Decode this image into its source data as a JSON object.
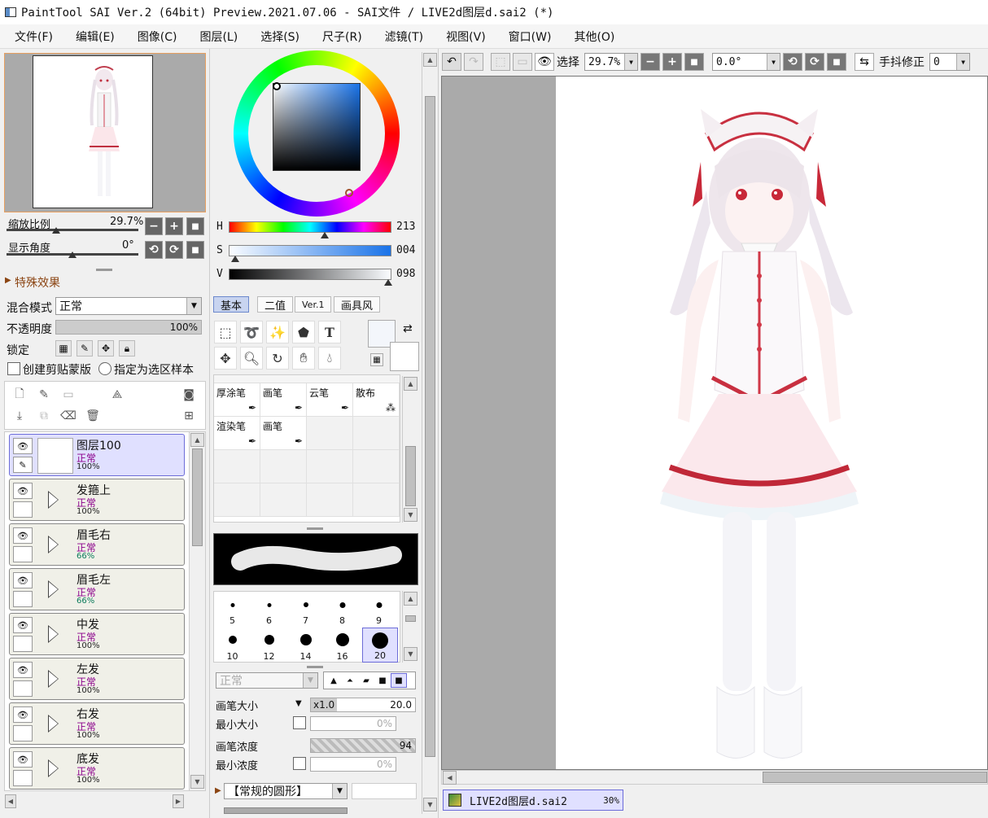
{
  "window": {
    "title": "PaintTool SAI Ver.2 (64bit) Preview.2021.07.06 - SAI文件 / LIVE2d图层d.sai2 (*)"
  },
  "menu": [
    "文件(F)",
    "编辑(E)",
    "图像(C)",
    "图层(L)",
    "选择(S)",
    "尺子(R)",
    "滤镜(T)",
    "视图(V)",
    "窗口(W)",
    "其他(O)"
  ],
  "navigator": {
    "zoom_label": "缩放比例",
    "zoom_value": "29.7%",
    "angle_label": "显示角度",
    "angle_value": "0°",
    "minus": "−",
    "plus": "+",
    "reset": "■",
    "rotate_ccw": "⟲",
    "rotate_cw": "⟳"
  },
  "layer_panel": {
    "effects_label": "特殊效果",
    "blend_label": "混合模式",
    "blend_value": "正常",
    "opacity_label": "不透明度",
    "opacity_value": "100%",
    "lock_label": "锁定",
    "clip_label": "创建剪贴蒙版",
    "selection_source_label": "指定为选区样本",
    "layers": [
      {
        "name": "图层100",
        "mode": "正常",
        "opacity": "100%",
        "type": "layer",
        "selected": true
      },
      {
        "name": "发箍上",
        "mode": "正常",
        "opacity": "100%",
        "type": "folder"
      },
      {
        "name": "眉毛右",
        "mode": "正常",
        "opacity": "66%",
        "type": "folder"
      },
      {
        "name": "眉毛左",
        "mode": "正常",
        "opacity": "66%",
        "type": "folder"
      },
      {
        "name": "中发",
        "mode": "正常",
        "opacity": "100%",
        "type": "folder"
      },
      {
        "name": "左发",
        "mode": "正常",
        "opacity": "100%",
        "type": "folder"
      },
      {
        "name": "右发",
        "mode": "正常",
        "opacity": "100%",
        "type": "folder"
      },
      {
        "name": "底发",
        "mode": "正常",
        "opacity": "100%",
        "type": "folder"
      }
    ]
  },
  "color_panel": {
    "h_label": "H",
    "h_value": "213",
    "s_label": "S",
    "s_value": "004",
    "v_label": "V",
    "v_value": "098",
    "h_level": 0.59,
    "s_level": 0.04,
    "v_level": 0.98
  },
  "tool_tabs": [
    "基本",
    "二值",
    "Ver.1",
    "画具风"
  ],
  "brushes": [
    "厚涂笔",
    "画笔",
    "云笔",
    "散布",
    "渲染笔",
    "画笔"
  ],
  "brush_sizes": [
    "5",
    "6",
    "7",
    "8",
    "9",
    "10",
    "12",
    "14",
    "16",
    "20"
  ],
  "brush_settings": {
    "mode_value": "正常",
    "size_label": "画笔大小",
    "size_multiplier": "x1.0",
    "size_value": "20.0",
    "min_size_label": "最小大小",
    "min_size_value": "0%",
    "density_label": "画笔浓度",
    "density_value": "94",
    "min_density_label": "最小浓度",
    "min_density_value": "0%",
    "shape_value": "【常规的圆形】"
  },
  "canvas_toolbar": {
    "selection_label": "选择",
    "zoom_value": "29.7%",
    "angle_value": "0.0°",
    "stabilizer_label": "手抖修正",
    "stabilizer_value": "0"
  },
  "file_tabs": [
    {
      "name": "LIVE2d图层d.sai2",
      "zoom": "30%"
    }
  ]
}
